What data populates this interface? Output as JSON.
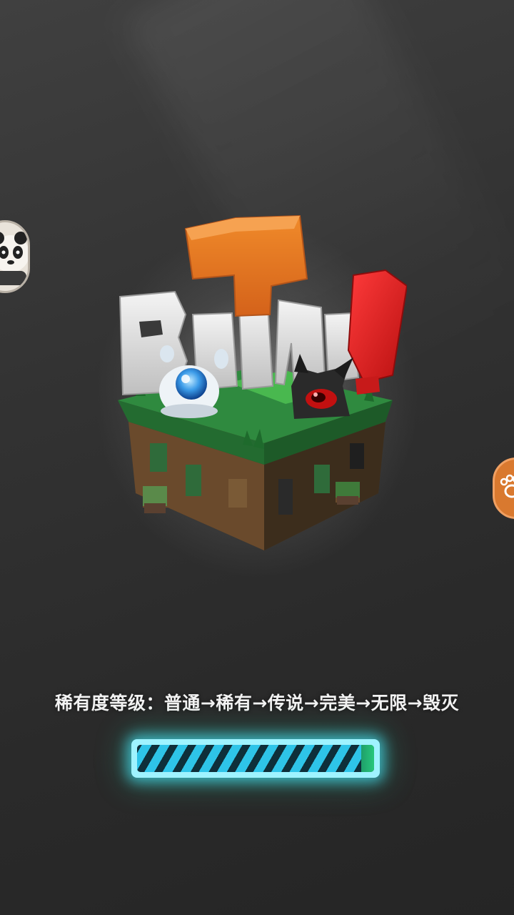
{
  "loading": {
    "tip_text": "稀有度等级：普通→稀有→传说→完美→无限→毁灭",
    "progress": 0.95
  },
  "logo": {
    "text": "Boing!"
  },
  "side_buttons": {
    "left_icon": "panda-icon",
    "right_icon": "paw-icon"
  },
  "colors": {
    "background": "#2e2e2e",
    "progress_glow": "#46dcf0",
    "progress_stripe": "#2ec4e8",
    "grass": "#2f8a3f",
    "orange_block": "#e8731f",
    "red_block": "#d81e1e"
  }
}
